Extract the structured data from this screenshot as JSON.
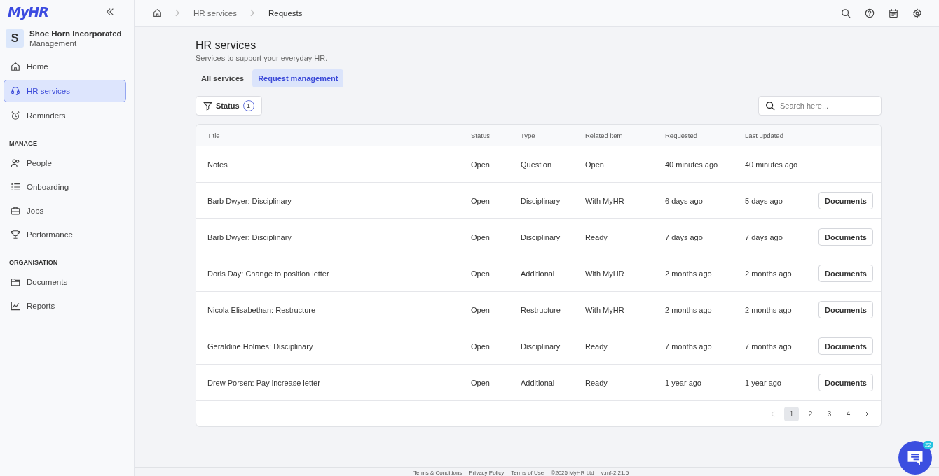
{
  "sidebar": {
    "logo": "MyHR",
    "org": {
      "initial": "S",
      "name": "Shoe Horn Incorporated",
      "role": "Management"
    },
    "groups": [
      {
        "items": [
          {
            "label": "Home",
            "kind": "home",
            "selected": false
          },
          {
            "label": "HR services",
            "kind": "headset",
            "selected": true
          },
          {
            "label": "Reminders",
            "kind": "alarm",
            "selected": false
          }
        ]
      },
      {
        "heading": "MANAGE",
        "items": [
          {
            "label": "People",
            "kind": "people",
            "selected": false
          },
          {
            "label": "Onboarding",
            "kind": "list",
            "selected": false
          },
          {
            "label": "Jobs",
            "kind": "briefcase",
            "selected": false
          },
          {
            "label": "Performance",
            "kind": "trophy",
            "selected": false
          }
        ]
      },
      {
        "heading": "ORGANISATION",
        "items": [
          {
            "label": "Documents",
            "kind": "folder",
            "selected": false
          },
          {
            "label": "Reports",
            "kind": "chart",
            "selected": false
          }
        ]
      }
    ]
  },
  "breadcrumbs": [
    "HR services",
    "Requests"
  ],
  "page": {
    "title": "HR services",
    "subtitle": "Services to support your everyday HR."
  },
  "tabs": [
    {
      "label": "All services",
      "selected": false
    },
    {
      "label": "Request management",
      "selected": true
    }
  ],
  "filter": {
    "label": "Status",
    "count": "1"
  },
  "search": {
    "placeholder": "Search here..."
  },
  "table": {
    "columns": [
      "Title",
      "Status",
      "Type",
      "Related item",
      "Requested",
      "Last updated"
    ],
    "rows": [
      {
        "cells": [
          "Notes",
          "Open",
          "Question",
          "Open",
          "40 minutes ago",
          "40 minutes ago"
        ]
      },
      {
        "cells": [
          "Barb Dwyer: Disciplinary",
          "Open",
          "Disciplinary",
          "With MyHR",
          "6 days ago",
          "5 days ago"
        ],
        "action": "Documents"
      },
      {
        "cells": [
          "Barb Dwyer: Disciplinary",
          "Open",
          "Disciplinary",
          "Ready",
          "7 days ago",
          "7 days ago"
        ],
        "action": "Documents"
      },
      {
        "cells": [
          "Doris Day: Change to position letter",
          "Open",
          "Additional",
          "With MyHR",
          "2 months ago",
          "2 months ago"
        ],
        "action": "Documents"
      },
      {
        "cells": [
          "Nicola Elisabethan: Restructure",
          "Open",
          "Restructure",
          "With MyHR",
          "2 months ago",
          "2 months ago"
        ],
        "action": "Documents"
      },
      {
        "cells": [
          "Geraldine Holmes: Disciplinary",
          "Open",
          "Disciplinary",
          "Ready",
          "7 months ago",
          "7 months ago"
        ],
        "action": "Documents"
      },
      {
        "cells": [
          "Drew Porsen: Pay increase letter",
          "Open",
          "Additional",
          "Ready",
          "1 year ago",
          "1 year ago"
        ],
        "action": "Documents"
      }
    ]
  },
  "pagination": [
    {
      "label": "1",
      "selected": true
    },
    {
      "label": "2",
      "selected": false
    },
    {
      "label": "3",
      "selected": false
    },
    {
      "label": "4",
      "selected": false
    }
  ],
  "footer": [
    "Terms & Conditions",
    "Privacy Policy",
    "Terms of Use",
    "©2025 MyHR Ltd",
    "v.mf-2.21.5"
  ],
  "chat": {
    "badge": "22"
  }
}
